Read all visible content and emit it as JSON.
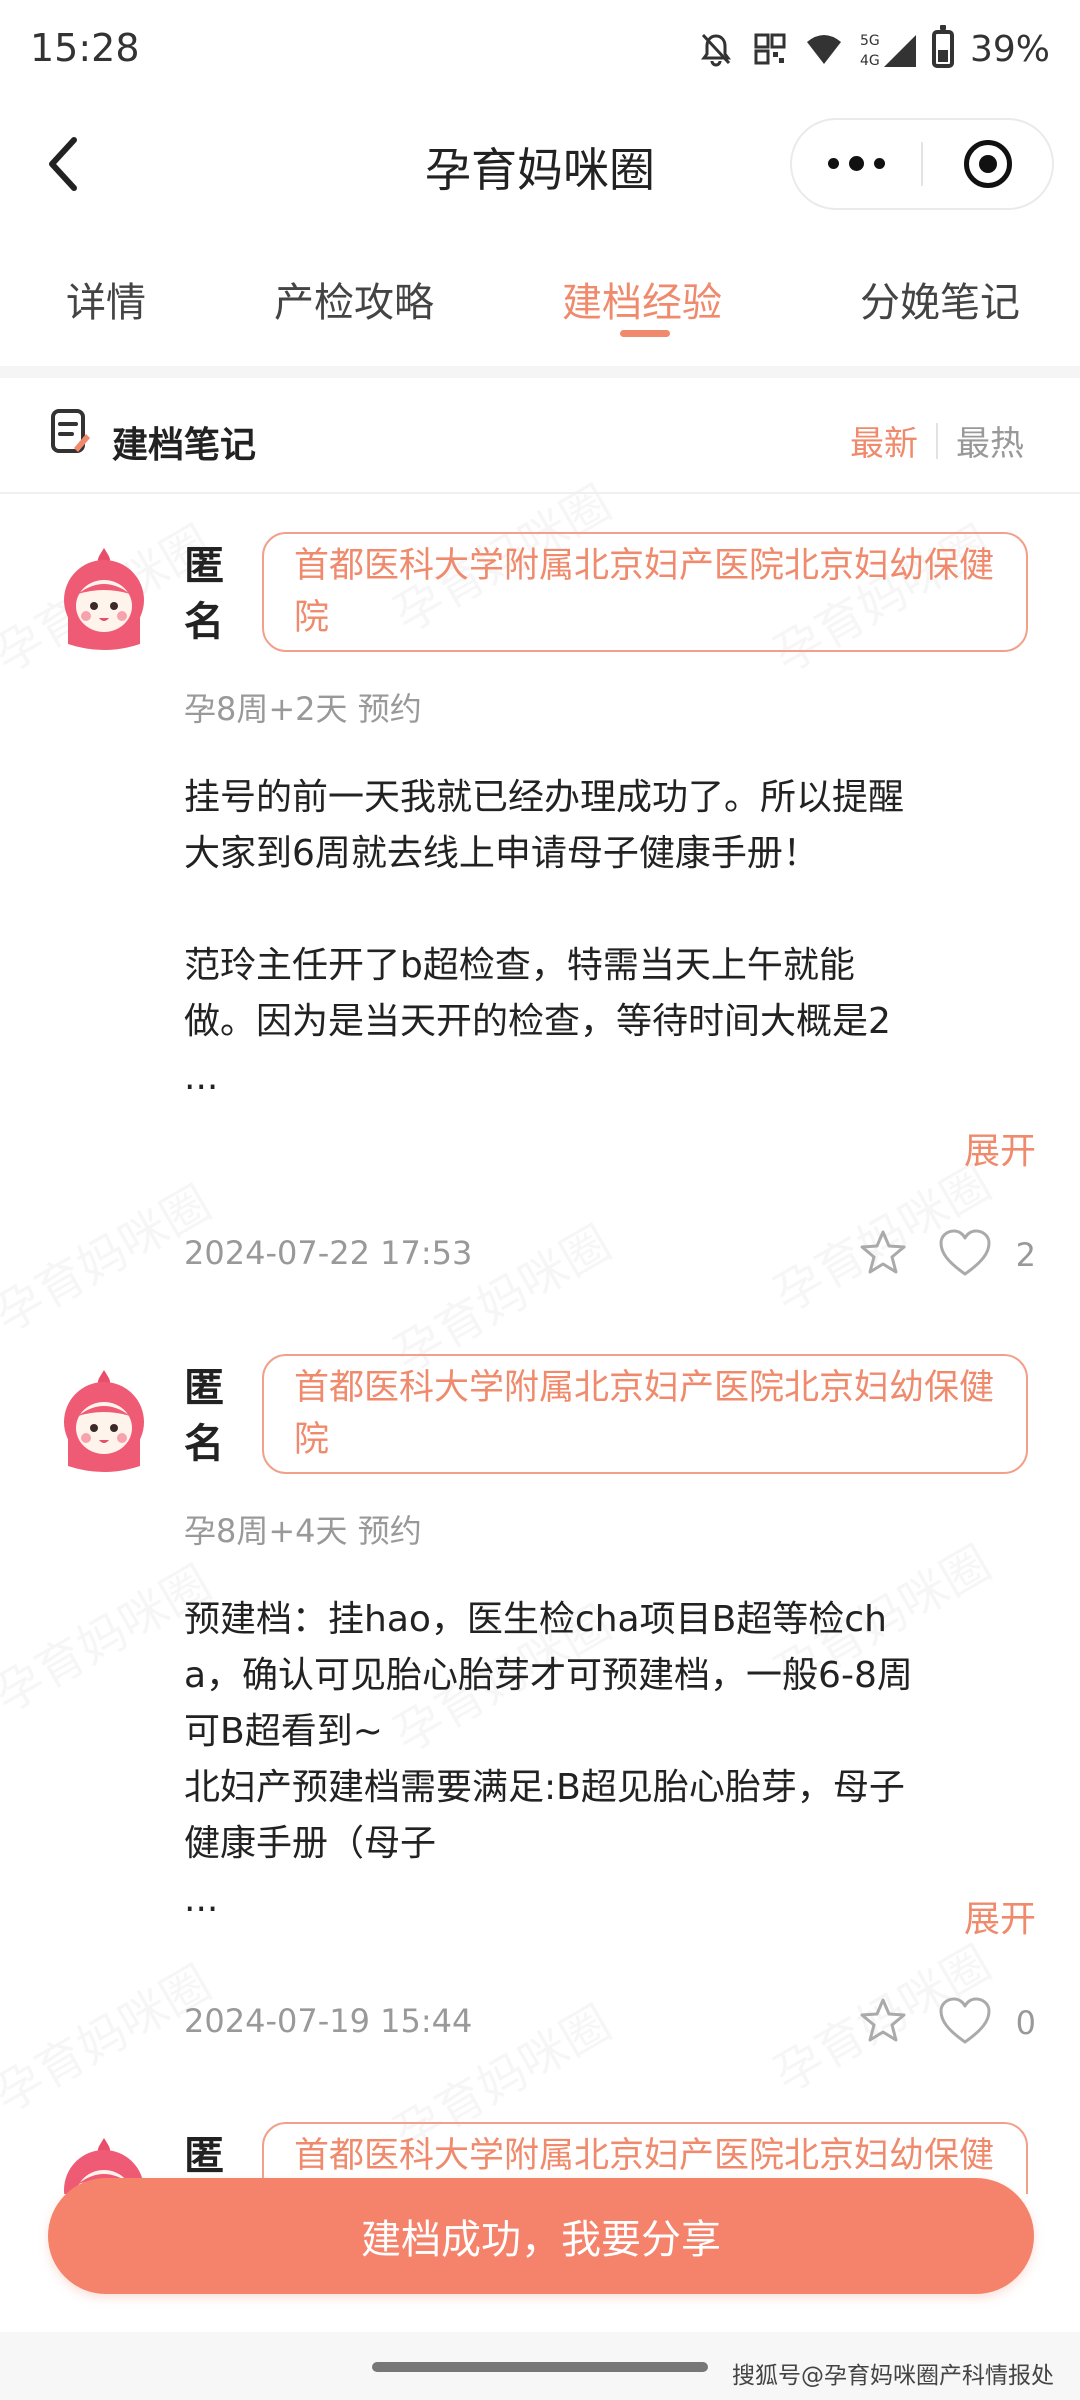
{
  "status_bar": {
    "time": "15:28",
    "battery": "39%",
    "battery_level": 0.39,
    "network": "5G 4G"
  },
  "nav": {
    "title": "孕育妈咪圈"
  },
  "tabs": [
    {
      "label": "详情"
    },
    {
      "label": "产检攻略"
    },
    {
      "label": "建档经验"
    },
    {
      "label": "分娩笔记"
    }
  ],
  "section": {
    "title": "建档笔记",
    "sort_latest": "最新",
    "sort_hot": "最热"
  },
  "posts": [
    {
      "author": "匿名",
      "hospital": "首都医科大学附属北京妇产医院北京妇幼保健院",
      "meta": "孕8周+2天 预约",
      "content": "挂号的前一天我就已经办理成功了。所以提醒大家到6周就去线上申请母子健康手册！\n\n范玲主任开了b超检查，特需当天上午就能做。因为是当天开的检查，等待时间大概是2\n...",
      "expand": "展开",
      "date": "2024-07-22 17:53",
      "likes": "2"
    },
    {
      "author": "匿名",
      "hospital": "首都医科大学附属北京妇产医院北京妇幼保健院",
      "meta": "孕8周+4天 预约",
      "content": "预建档：挂hao，医生检cha项目B超等检cha，确认可见胎心胎芽才可预建档，一般6-8周可B超看到~\n北妇产预建档需要满足:B超见胎心胎芽，母子健康手册（母子\n...",
      "expand": "展开",
      "date": "2024-07-19 15:44",
      "likes": "0"
    },
    {
      "author": "匿名",
      "hospital": "首都医科大学附属北京妇产医院北京妇幼保健院"
    }
  ],
  "watermark": "孕育妈咪圈",
  "share_button": "建档成功，我要分享",
  "credit": "搜狐号@孕育妈咪圈产科情报处",
  "colors": {
    "accent": "#f08a6c",
    "button": "#f5826b",
    "muted": "#999999"
  }
}
